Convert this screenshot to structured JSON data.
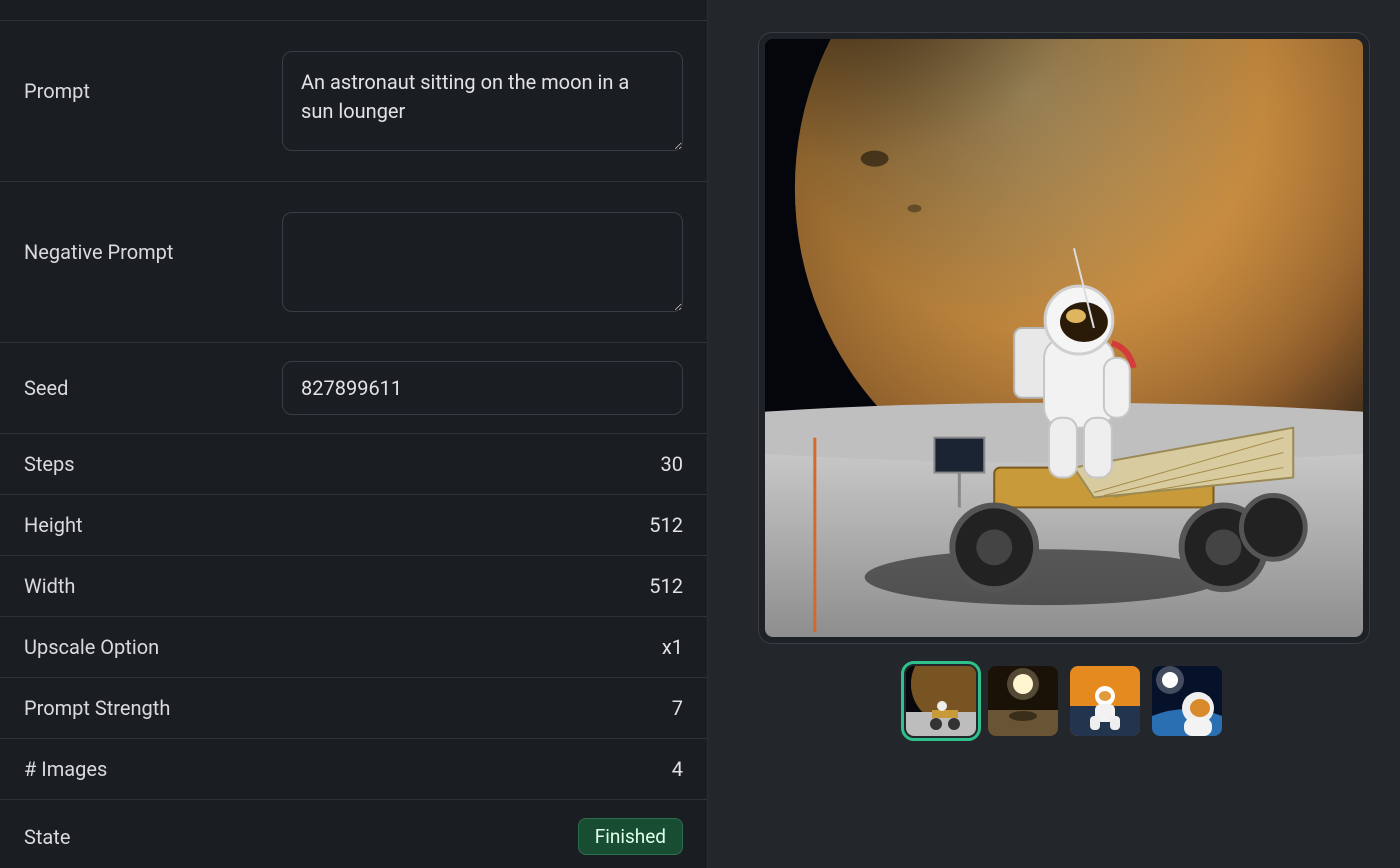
{
  "labels": {
    "prompt": "Prompt",
    "negative_prompt": "Negative Prompt",
    "seed": "Seed",
    "steps": "Steps",
    "height": "Height",
    "width": "Width",
    "upscale": "Upscale Option",
    "prompt_strength": "Prompt Strength",
    "num_images": "# Images",
    "state": "State"
  },
  "values": {
    "prompt": "An astronaut sitting on the moon in a sun lounger",
    "negative_prompt": "",
    "seed": "827899611",
    "steps": "30",
    "height": "512",
    "width": "512",
    "upscale": "x1",
    "prompt_strength": "7",
    "num_images": "4",
    "state": "Finished"
  },
  "gallery": {
    "selected_index": 0,
    "thumbnails": [
      {
        "name": "thumb-1"
      },
      {
        "name": "thumb-2"
      },
      {
        "name": "thumb-3"
      },
      {
        "name": "thumb-4"
      }
    ]
  }
}
